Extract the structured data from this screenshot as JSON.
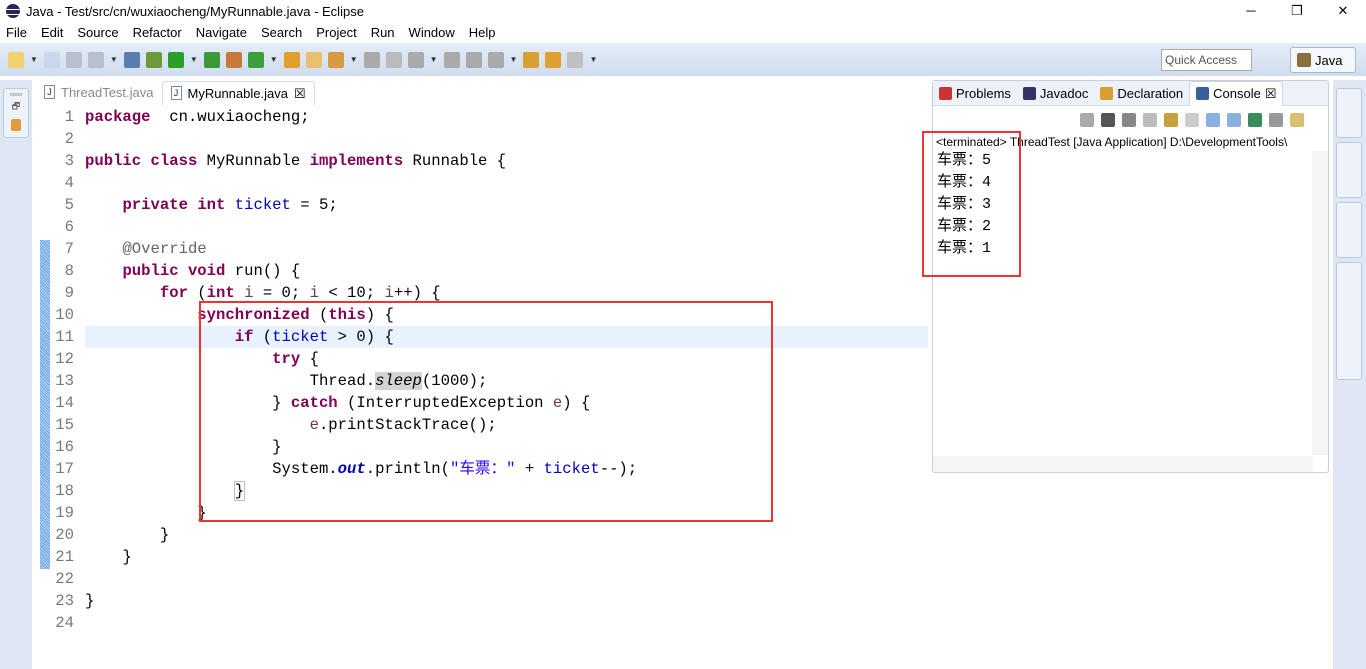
{
  "window": {
    "title": "Java - Test/src/cn/wuxiaocheng/MyRunnable.java - Eclipse",
    "minimize": "─",
    "maximize": "❐",
    "close": "✕"
  },
  "menu": [
    "File",
    "Edit",
    "Source",
    "Refactor",
    "Navigate",
    "Search",
    "Project",
    "Run",
    "Window",
    "Help"
  ],
  "toolbar": {
    "quick_access_placeholder": "Quick Access",
    "perspective": "Java"
  },
  "editor": {
    "tabs": [
      {
        "label": "ThreadTest.java",
        "active": false
      },
      {
        "label": "MyRunnable.java",
        "active": true,
        "close": "☒"
      }
    ],
    "current_line": 11,
    "lines": [
      [
        [
          "kw",
          "package"
        ],
        [
          "",
          "  cn.wuxiaocheng;"
        ]
      ],
      [],
      [
        [
          "kw",
          "public"
        ],
        [
          "",
          " "
        ],
        [
          "kw",
          "class"
        ],
        [
          "",
          " MyRunnable "
        ],
        [
          "kw",
          "implements"
        ],
        [
          "",
          " Runnable {"
        ]
      ],
      [],
      [
        [
          "",
          "    "
        ],
        [
          "kw",
          "private"
        ],
        [
          "",
          " "
        ],
        [
          "kw",
          "int"
        ],
        [
          "",
          " "
        ],
        [
          "fld",
          "ticket"
        ],
        [
          "",
          " = 5;"
        ]
      ],
      [],
      [
        [
          "",
          "    "
        ],
        [
          "ann",
          "@Override"
        ]
      ],
      [
        [
          "",
          "    "
        ],
        [
          "kw",
          "public"
        ],
        [
          "",
          " "
        ],
        [
          "kw",
          "void"
        ],
        [
          "",
          " run() {"
        ]
      ],
      [
        [
          "",
          "        "
        ],
        [
          "kw",
          "for"
        ],
        [
          "",
          " ("
        ],
        [
          "kw",
          "int"
        ],
        [
          "",
          " "
        ],
        [
          "var",
          "i"
        ],
        [
          "",
          " = 0; "
        ],
        [
          "var",
          "i"
        ],
        [
          "",
          " < 10; "
        ],
        [
          "var",
          "i"
        ],
        [
          "",
          "++) {"
        ]
      ],
      [
        [
          "",
          "            "
        ],
        [
          "kw",
          "synchronized"
        ],
        [
          "",
          " ("
        ],
        [
          "kw",
          "this"
        ],
        [
          "",
          ") {"
        ]
      ],
      [
        [
          "",
          "                "
        ],
        [
          "kw",
          "if"
        ],
        [
          "",
          " ("
        ],
        [
          "fld",
          "ticket"
        ],
        [
          "",
          " > 0) {"
        ]
      ],
      [
        [
          "",
          "                    "
        ],
        [
          "kw",
          "try"
        ],
        [
          "",
          " {"
        ]
      ],
      [
        [
          "",
          "                        Thread."
        ],
        [
          "sti",
          "sleep"
        ],
        [
          "",
          "(1000);"
        ]
      ],
      [
        [
          "",
          "                    } "
        ],
        [
          "kw",
          "catch"
        ],
        [
          "",
          " (InterruptedException "
        ],
        [
          "var",
          "e"
        ],
        [
          "",
          ") {"
        ]
      ],
      [
        [
          "",
          "                        "
        ],
        [
          "var",
          "e"
        ],
        [
          "",
          ".printStackTrace();"
        ]
      ],
      [
        [
          "",
          "                    }"
        ]
      ],
      [
        [
          "",
          "                    System."
        ],
        [
          "smi",
          "out"
        ],
        [
          "",
          ".println("
        ],
        [
          "str",
          "\"车票：\""
        ],
        [
          "",
          " + "
        ],
        [
          "fld",
          "ticket"
        ],
        [
          "",
          "--);"
        ]
      ],
      [
        [
          "",
          "                "
        ],
        [
          "brk",
          "}"
        ]
      ],
      [
        [
          "",
          "            }"
        ]
      ],
      [
        [
          "",
          "        }"
        ]
      ],
      [
        [
          "",
          "    }"
        ]
      ],
      [],
      [
        [
          "",
          "}"
        ]
      ],
      []
    ]
  },
  "console_view": {
    "tabs": [
      {
        "label": "Problems",
        "icon": "problems-icon"
      },
      {
        "label": "Javadoc",
        "icon": "at-icon"
      },
      {
        "label": "Declaration",
        "icon": "declaration-icon"
      },
      {
        "label": "Console",
        "icon": "console-icon",
        "active": true,
        "close": "☒"
      }
    ],
    "status": "<terminated> ThreadTest [Java Application] D:\\DevelopmentTools\\",
    "output": [
      "车票：5",
      "车票：4",
      "车票：3",
      "车票：2",
      "车票：1"
    ]
  },
  "colors": {
    "highlight_box": "#ee3333",
    "keyword": "#7f0055",
    "field": "#0000c0",
    "string": "#2a00ff"
  }
}
